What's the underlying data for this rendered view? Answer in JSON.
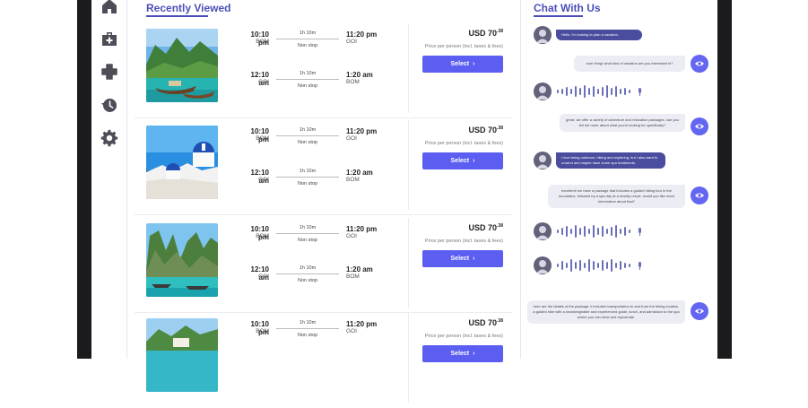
{
  "section_titles": {
    "recently_viewed": "Recently Viewed",
    "chat": "Chat With Us"
  },
  "sidebar": {
    "items": [
      {
        "icon": "home-icon"
      },
      {
        "icon": "medical-bag-icon"
      },
      {
        "icon": "plus-icon"
      },
      {
        "icon": "history-icon"
      },
      {
        "icon": "settings-icon"
      }
    ]
  },
  "colors": {
    "accent": "#5b5ef0",
    "title": "#4b4fb8",
    "user_bubble": "#4a4c9e",
    "bot_bubble": "#ececf5"
  },
  "flights": [
    {
      "image": "thai-boats-beach",
      "outbound": {
        "dep_time": "10:10 pm",
        "dep_code": "BOM",
        "duration": "1h 10m",
        "stops": "Non stop",
        "arr_time": "11:20 pm",
        "arr_code": "GOI"
      },
      "return": {
        "dep_time": "12:10 am",
        "dep_code": "GOI",
        "duration": "1h 10m",
        "stops": "Non stop",
        "arr_time": "1:20 am",
        "arr_code": "BOM"
      },
      "price_main": "USD 70",
      "price_cents": ".38",
      "price_note": "Price per person (incl. taxes & fees)",
      "select_label": "Select"
    },
    {
      "image": "santorini-domes",
      "outbound": {
        "dep_time": "10:10 pm",
        "dep_code": "BOM",
        "duration": "1h 10m",
        "stops": "Non stop",
        "arr_time": "11:20 pm",
        "arr_code": "GOI"
      },
      "return": {
        "dep_time": "12:10 am",
        "dep_code": "GOI",
        "duration": "1h 10m",
        "stops": "Non stop",
        "arr_time": "1:20 am",
        "arr_code": "BOM"
      },
      "price_main": "USD 70",
      "price_cents": ".38",
      "price_note": "Price per person (incl. taxes & fees)",
      "select_label": "Select"
    },
    {
      "image": "limestone-bay",
      "outbound": {
        "dep_time": "10:10 pm",
        "dep_code": "BOM",
        "duration": "1h 10m",
        "stops": "Non stop",
        "arr_time": "11:20 pm",
        "arr_code": "GOI"
      },
      "return": {
        "dep_time": "12:10 am",
        "dep_code": "GOI",
        "duration": "1h 10m",
        "stops": "Non stop",
        "arr_time": "1:20 am",
        "arr_code": "BOM"
      },
      "price_main": "USD 70",
      "price_cents": ".38",
      "price_note": "Price per person (incl. taxes & fees)",
      "select_label": "Select"
    },
    {
      "image": "island-resort",
      "outbound": {
        "dep_time": "10:10 pm",
        "dep_code": "BOM",
        "duration": "1h 10m",
        "stops": "Non stop",
        "arr_time": "11:20 pm",
        "arr_code": "GOI"
      },
      "price_main": "USD 70",
      "price_cents": ".38",
      "price_note": "Price per person (incl. taxes & fees)",
      "select_label": "Select"
    }
  ],
  "chat": {
    "messages": [
      {
        "from": "user",
        "type": "text",
        "text": "Hello, I'm looking to plan a vacation."
      },
      {
        "from": "agent",
        "type": "text",
        "text": "sure thing! what kind of vacation are you interested in?"
      },
      {
        "from": "user",
        "type": "voice"
      },
      {
        "from": "agent",
        "type": "text",
        "text": "great, we offer a variety of adventure and relaxation packages. can you tell me more about what you're looking for specifically?"
      },
      {
        "from": "user",
        "type": "text",
        "text": "I love being outdoors, hiking and exploring, but i also want to unwind and maybe have some spa treatments."
      },
      {
        "from": "agent",
        "type": "text",
        "text": "excellent! we have a package that includes a guided hiking tour in the mountains, followed by a spa day at a nearby resort. would you like more information about that?"
      },
      {
        "from": "user",
        "type": "voice"
      },
      {
        "from": "user",
        "type": "voice"
      },
      {
        "from": "agent",
        "type": "text",
        "text": "here are the details of the package: it includes transportation to and from the hiking location, a guided hike with a knowledgeable and experienced guide, lunch, and admission to the spa where you can relax and rejuvenate."
      }
    ]
  }
}
